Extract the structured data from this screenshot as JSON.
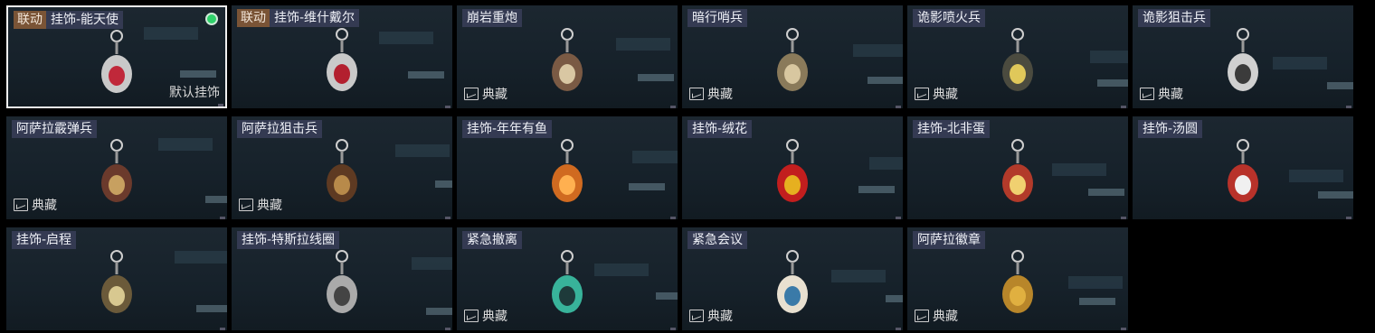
{
  "items": [
    {
      "collab": "联动",
      "name": "挂饰-能天使",
      "rarity": "",
      "default": "默认挂饰",
      "selected": true,
      "equipped": true,
      "icon": "angel-tag-charm-icon"
    },
    {
      "collab": "联动",
      "name": "挂饰-维什戴尔",
      "rarity": "",
      "default": "",
      "selected": false,
      "equipped": false,
      "icon": "tag-charm-icon"
    },
    {
      "collab": "",
      "name": "崩岩重炮",
      "rarity": "典藏",
      "default": "",
      "selected": false,
      "equipped": false,
      "icon": "gunner-figure-icon"
    },
    {
      "collab": "",
      "name": "暗行哨兵",
      "rarity": "典藏",
      "default": "",
      "selected": false,
      "equipped": false,
      "icon": "sentry-figure-icon"
    },
    {
      "collab": "",
      "name": "诡影喷火兵",
      "rarity": "典藏",
      "default": "",
      "selected": false,
      "equipped": false,
      "icon": "flamer-figure-icon"
    },
    {
      "collab": "",
      "name": "诡影狙击兵",
      "rarity": "典藏",
      "default": "",
      "selected": false,
      "equipped": false,
      "icon": "sniper-figure-icon"
    },
    {
      "collab": "",
      "name": "阿萨拉霰弹兵",
      "rarity": "典藏",
      "default": "",
      "selected": false,
      "equipped": false,
      "icon": "shotgunner-figure-icon"
    },
    {
      "collab": "",
      "name": "阿萨拉狙击兵",
      "rarity": "典藏",
      "default": "",
      "selected": false,
      "equipped": false,
      "icon": "sniper-soldier-figure-icon"
    },
    {
      "collab": "",
      "name": "挂饰-年年有鱼",
      "rarity": "",
      "default": "",
      "selected": false,
      "equipped": false,
      "icon": "fish-charm-icon"
    },
    {
      "collab": "",
      "name": "挂饰-绒花",
      "rarity": "",
      "default": "",
      "selected": false,
      "equipped": false,
      "icon": "flower-charm-icon"
    },
    {
      "collab": "",
      "name": "挂饰-北非蛋",
      "rarity": "",
      "default": "",
      "selected": false,
      "equipped": false,
      "icon": "egg-pan-charm-icon"
    },
    {
      "collab": "",
      "name": "挂饰-汤圆",
      "rarity": "",
      "default": "",
      "selected": false,
      "equipped": false,
      "icon": "dumpling-bowl-charm-icon"
    },
    {
      "collab": "",
      "name": "挂饰-启程",
      "rarity": "",
      "default": "",
      "selected": false,
      "equipped": false,
      "icon": "triangle-emblem-charm-icon"
    },
    {
      "collab": "",
      "name": "挂饰-特斯拉线圈",
      "rarity": "",
      "default": "",
      "selected": false,
      "equipped": false,
      "icon": "tesla-coil-charm-icon"
    },
    {
      "collab": "",
      "name": "紧急撤离",
      "rarity": "典藏",
      "default": "",
      "selected": false,
      "equipped": false,
      "icon": "evac-tag-charm-icon"
    },
    {
      "collab": "",
      "name": "紧急会议",
      "rarity": "典藏",
      "default": "",
      "selected": false,
      "equipped": false,
      "icon": "meeting-badge-charm-icon"
    },
    {
      "collab": "",
      "name": "阿萨拉徽章",
      "rarity": "典藏",
      "default": "",
      "selected": false,
      "equipped": false,
      "icon": "medal-charm-icon"
    }
  ]
}
